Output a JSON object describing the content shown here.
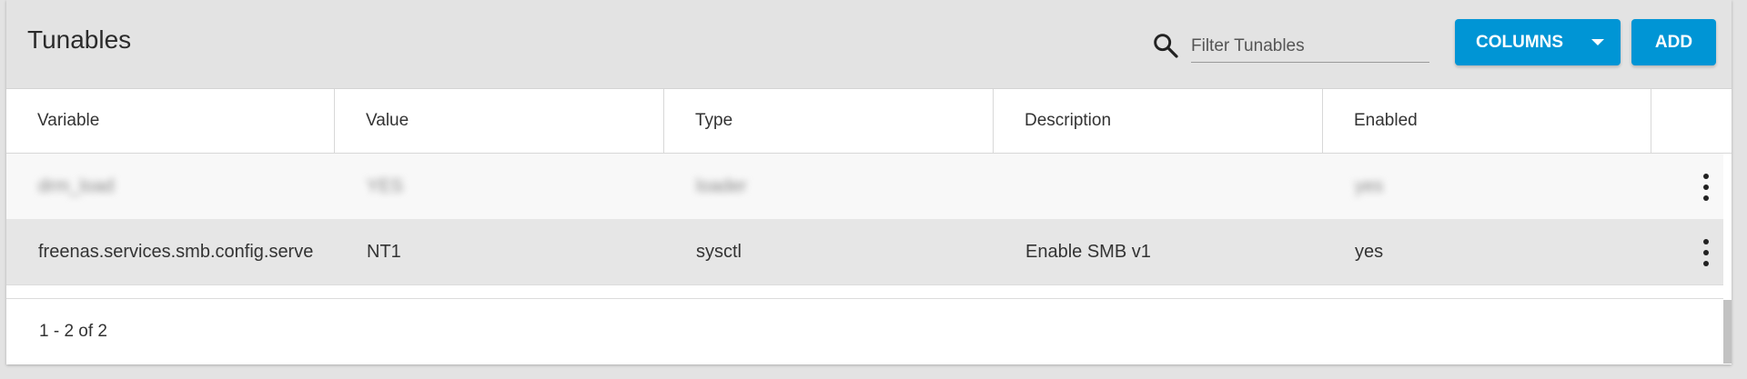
{
  "page": {
    "title": "Tunables"
  },
  "toolbar": {
    "filter_placeholder": "Filter Tunables",
    "columns_label": "COLUMNS",
    "add_label": "ADD"
  },
  "table": {
    "columns": [
      "Variable",
      "Value",
      "Type",
      "Description",
      "Enabled"
    ],
    "rows": [
      {
        "variable": "drm_load",
        "value": "YES",
        "type": "loader",
        "description": "",
        "enabled": "yes"
      },
      {
        "variable": "freenas.services.smb.config.serve",
        "value": "NT1",
        "type": "sysctl",
        "description": "Enable SMB v1",
        "enabled": "yes"
      }
    ]
  },
  "footer": {
    "pagination": "1 - 2 of 2"
  },
  "colors": {
    "accent": "#0095d5",
    "header_bg": "#e3e3e3"
  }
}
